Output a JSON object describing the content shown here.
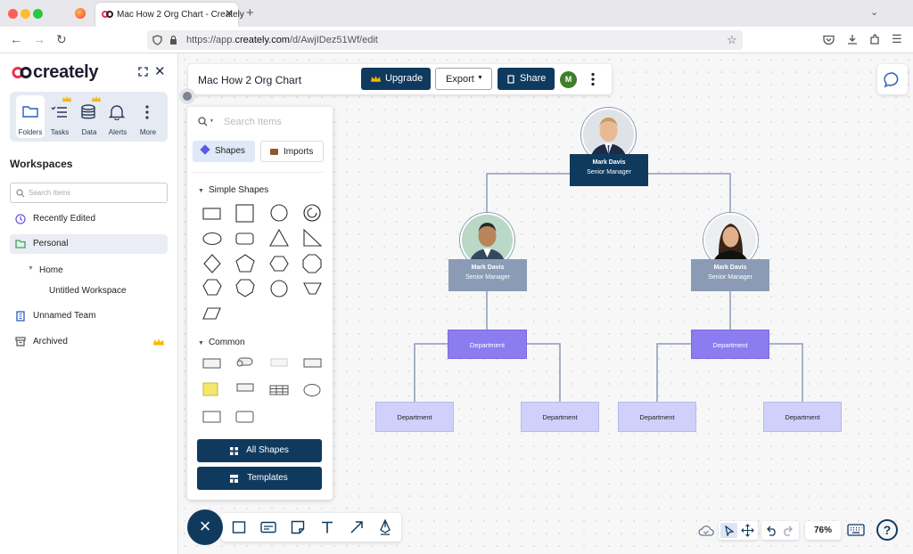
{
  "browser": {
    "tab_title": "Mac How 2 Org Chart - Creately",
    "url_prefix": "https://app.",
    "url_domain": "creately.com",
    "url_path": "/d/AwjIDez51Wf/edit"
  },
  "sidebar": {
    "logo": "creately",
    "icons": [
      {
        "label": "Folders",
        "icon": "folder-icon"
      },
      {
        "label": "Tasks",
        "icon": "tasks-icon"
      },
      {
        "label": "Data",
        "icon": "database-icon"
      },
      {
        "label": "Alerts",
        "icon": "bell-icon"
      },
      {
        "label": "More",
        "icon": "more-vertical-icon"
      }
    ],
    "workspaces_title": "Workspaces",
    "search_placeholder": "Search Items",
    "items": [
      {
        "label": "Recently Edited"
      },
      {
        "label": "Personal"
      },
      {
        "label": "Home"
      },
      {
        "label": "Untitled Workspace"
      },
      {
        "label": "Unnamed Team"
      },
      {
        "label": "Archived"
      }
    ]
  },
  "topbar": {
    "doc_title": "Mac How 2 Org Chart",
    "upgrade_label": "Upgrade",
    "export_label": "Export",
    "share_label": "Share",
    "avatar_initial": "M"
  },
  "shapes_panel": {
    "search_placeholder": "Search Items",
    "shapes_tab": "Shapes",
    "imports_tab": "Imports",
    "simple_shapes_title": "Simple Shapes",
    "common_title": "Common",
    "all_shapes_label": "All Shapes",
    "templates_label": "Templates"
  },
  "zoom": "76%",
  "org_chart": {
    "root": {
      "name": "Mark Davis",
      "role": "Senior Manager"
    },
    "left": {
      "name": "Mark Davis",
      "role": "Senior Manager"
    },
    "right": {
      "name": "Mark Davis",
      "role": "Senior Manager"
    },
    "department_label": "Department"
  },
  "colors": {
    "primary": "#0f3a5e",
    "manager_box": "#8c9bb5",
    "dept_mid": "#8c7cf0",
    "dept_low": "#d0d0fa",
    "root_box": "#0f3a5e"
  }
}
